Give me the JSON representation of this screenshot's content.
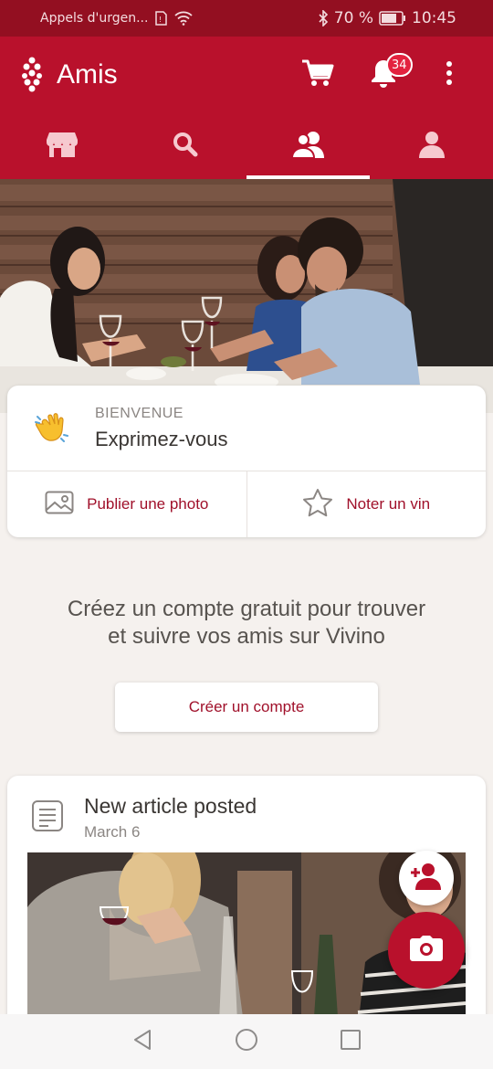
{
  "status_bar": {
    "carrier": "Appels d'urgen...",
    "battery": "70 %",
    "time": "10:45",
    "icons": [
      "sim-icon",
      "wifi-icon",
      "bluetooth-icon",
      "battery-icon"
    ]
  },
  "app_bar": {
    "title": "Amis",
    "notification_count": "34",
    "icons": [
      "vivino-logo",
      "cart-icon",
      "bell-icon",
      "more-vert-icon"
    ]
  },
  "tabs": [
    {
      "icon": "store-icon",
      "active": false
    },
    {
      "icon": "search-icon",
      "active": false
    },
    {
      "icon": "friends-icon",
      "active": true
    },
    {
      "icon": "profile-icon",
      "active": false
    }
  ],
  "welcome": {
    "label": "BIENVENUE",
    "title": "Exprimez-vous",
    "icon": "waving-hand-icon",
    "actions": [
      {
        "label": "Publier une photo",
        "icon": "photo-icon"
      },
      {
        "label": "Noter un vin",
        "icon": "star-icon"
      }
    ]
  },
  "signup": {
    "text_line1": "Créez un compte gratuit pour trouver",
    "text_line2": "et suivre vos amis sur Vivino",
    "button_label": "Créer un compte"
  },
  "article": {
    "title": "New article posted",
    "date": "March 6",
    "icon": "article-icon"
  },
  "fabs": {
    "add_friend_icon": "add-friend-icon",
    "camera_icon": "camera-icon"
  },
  "colors": {
    "brand": "#b9112c",
    "status_bar": "#930f21",
    "accent_text": "#a0102a",
    "background": "#f5f1ee"
  }
}
